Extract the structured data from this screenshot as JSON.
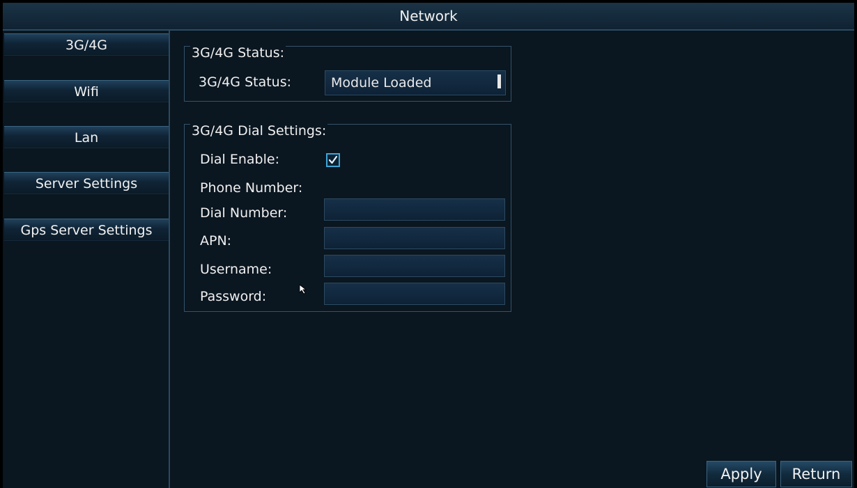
{
  "window": {
    "title": "Network"
  },
  "sidebar": {
    "items": [
      {
        "label": "3G/4G"
      },
      {
        "label": "Wifi"
      },
      {
        "label": "Lan"
      },
      {
        "label": "Server Settings"
      },
      {
        "label": "Gps Server Settings"
      }
    ]
  },
  "status_group": {
    "title": "3G/4G Status:",
    "status_label": "3G/4G Status:",
    "status_value": "Module Loaded"
  },
  "dial_group": {
    "title": "3G/4G Dial Settings:",
    "dial_enable_label": "Dial Enable:",
    "dial_enable_checked": true,
    "phone_number_label": "Phone Number:",
    "dial_number_label": "Dial Number:",
    "dial_number_value": "",
    "apn_label": "APN:",
    "apn_value": "",
    "username_label": "Username:",
    "username_value": "",
    "password_label": "Password:",
    "password_value": ""
  },
  "footer": {
    "apply_label": "Apply",
    "return_label": "Return"
  },
  "colors": {
    "background": "#0a1620",
    "accent": "#3fa6d8",
    "border": "#34546a"
  }
}
